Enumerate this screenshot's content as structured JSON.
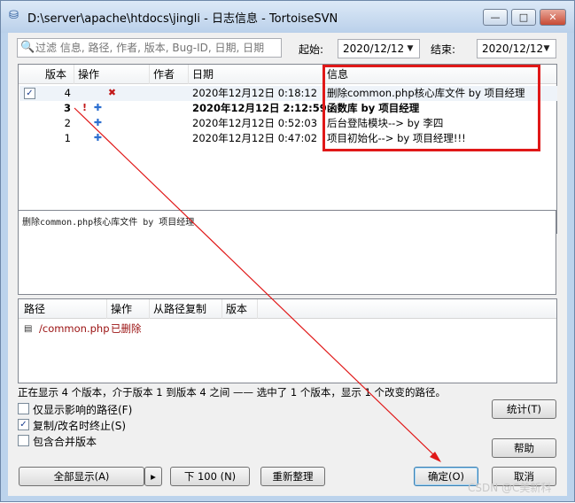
{
  "window": {
    "title": "D:\\server\\apache\\htdocs\\jingli - 日志信息 - TortoiseSVN",
    "title_icon": "svn-log-icon",
    "minimize": "—",
    "maximize": "□",
    "close": "✕"
  },
  "filter": {
    "search_placeholder": "过滤 信息, 路径, 作者, 版本, Bug-ID, 日期, 日期",
    "from_label": "起始:",
    "from_date": "2020/12/12",
    "to_label": "结束:",
    "to_date": "2020/12/12"
  },
  "log_table": {
    "columns": [
      "版本",
      "操作",
      "作者",
      "日期",
      "信息"
    ],
    "rows": [
      {
        "checked": true,
        "revision": "4",
        "actions": [
          "delete"
        ],
        "author": "",
        "date": "2020年12月12日 0:18:12",
        "message": "删除common.php核心库文件  by  项目经理",
        "bold": false
      },
      {
        "checked": false,
        "revision": "3",
        "actions": [
          "modify",
          "add"
        ],
        "author": "",
        "date": "2020年12月12日 2:12:59",
        "message": "函数库 by 项目经理",
        "bold": true
      },
      {
        "checked": false,
        "revision": "2",
        "actions": [
          "add"
        ],
        "author": "",
        "date": "2020年12月12日 0:52:03",
        "message": "后台登陆模块--> by 李四",
        "bold": false
      },
      {
        "checked": false,
        "revision": "1",
        "actions": [
          "add"
        ],
        "author": "",
        "date": "2020年12月12日 0:47:02",
        "message": "项目初始化--> by 项目经理!!!",
        "bold": false
      }
    ]
  },
  "message_panel": {
    "text": "删除common.php核心库文件  by  项目经理"
  },
  "paths_table": {
    "columns": [
      "路径",
      "操作",
      "从路径复制",
      "版本"
    ],
    "rows": [
      {
        "path": "/common.php",
        "action": "已删除",
        "copy_from": "",
        "revision": ""
      }
    ]
  },
  "status_text": "正在显示 4 个版本，介于版本 1 到版本 4 之间 —— 选中了 1 个版本，显示 1 个改变的路径。",
  "options": {
    "affected_paths_only": {
      "label": "仅显示影响的路径(F)",
      "checked": false
    },
    "stop_on_copy": {
      "label": "复制/改名时终止(S)",
      "checked": true
    },
    "include_merged": {
      "label": "包含合并版本",
      "checked": false
    }
  },
  "buttons": {
    "statistics": "统计(T)",
    "help": "帮助",
    "show_all": "全部显示(A)",
    "show_all_dropdown": "▸",
    "next_100": "下 100 (N)",
    "refresh": "重新整理",
    "ok": "确定(O)",
    "cancel": "取消"
  },
  "watermark": "CSDN @C美新科",
  "colors": {
    "annotation_red": "#e01818",
    "delete_red": "#c21818",
    "add_blue": "#2d6fd0",
    "path_deleted": "#9a1010"
  }
}
